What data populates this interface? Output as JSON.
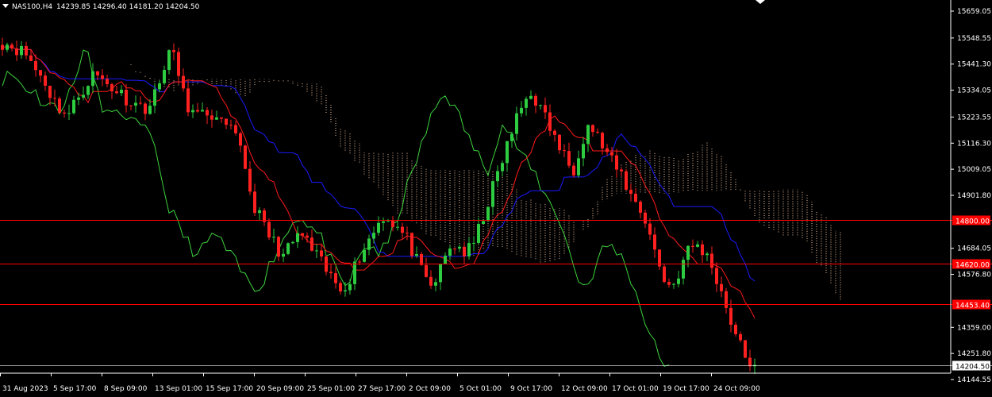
{
  "header": {
    "symbol": "NAS100,H4",
    "ohlc": "14239.85 14296.40 14181.20 14204.50"
  },
  "chart_data": {
    "type": "candlestick",
    "symbol": "NAS100",
    "timeframe": "H4",
    "ylim": [
      14144.55,
      15659.05
    ],
    "y_ticks": [
      "15659.05",
      "15548.55",
      "15441.30",
      "15334.05",
      "15223.55",
      "15116.30",
      "15009.05",
      "14901.80",
      "14684.05",
      "14576.80",
      "14359.00",
      "14251.80",
      "14144.55"
    ],
    "x_ticks": [
      "31 Aug 2023",
      "5 Sep 17:00",
      "8 Sep 09:00",
      "13 Sep 01:00",
      "15 Sep 17:00",
      "20 Sep 09:00",
      "25 Sep 01:00",
      "27 Sep 17:00",
      "2 Oct 09:00",
      "5 Oct 01:00",
      "9 Oct 17:00",
      "12 Oct 09:00",
      "17 Oct 01:00",
      "19 Oct 17:00",
      "24 Oct 09:00"
    ],
    "levels": [
      {
        "label": "14800.00",
        "value": 14800.0,
        "color": "#ff0000"
      },
      {
        "label": "14620.00",
        "value": 14620.0,
        "color": "#ff0000"
      },
      {
        "label": "14453.40",
        "value": 14453.4,
        "color": "#ff0000"
      }
    ],
    "current_price": {
      "label": "14204.50",
      "value": 14204.5,
      "color": "#ffffff"
    },
    "close_path": [
      15530,
      15520,
      15500,
      15480,
      15420,
      15380,
      15300,
      15260,
      15230,
      15300,
      15350,
      15400,
      15380,
      15350,
      15330,
      15300,
      15280,
      15260,
      15280,
      15360,
      15500,
      15450,
      15300,
      15240,
      15220,
      15250,
      15200,
      15180,
      15150,
      15100,
      14900,
      14820,
      14750,
      14700,
      14650,
      14700,
      14750,
      14700,
      14650,
      14600,
      14550,
      14520,
      14560,
      14640,
      14700,
      14760,
      14820,
      14800,
      14760,
      14720,
      14640,
      14560,
      14520,
      14600,
      14680,
      14700,
      14660,
      14700,
      14800,
      14900,
      15000,
      15100,
      15200,
      15280,
      15330,
      15260,
      15200,
      15120,
      15060,
      15000,
      15120,
      15200,
      15140,
      15080,
      15020,
      14980,
      14900,
      14860,
      14780,
      14660,
      14560,
      14520,
      14600,
      14680,
      14700,
      14660,
      14600,
      14500,
      14400,
      14300,
      14230,
      14204.5
    ],
    "colors": {
      "up": "#2ecc40",
      "down": "#ff2020",
      "tenkan": "#ff1a1a",
      "kijun": "#1a1aff",
      "chikou": "#3ed43e",
      "cloud": "#f3c6a5",
      "level": "#ff0000",
      "price_line": "#ffffff"
    }
  },
  "icons": {
    "dropdown": "triangle-down-icon",
    "position": "diamond-icon"
  }
}
